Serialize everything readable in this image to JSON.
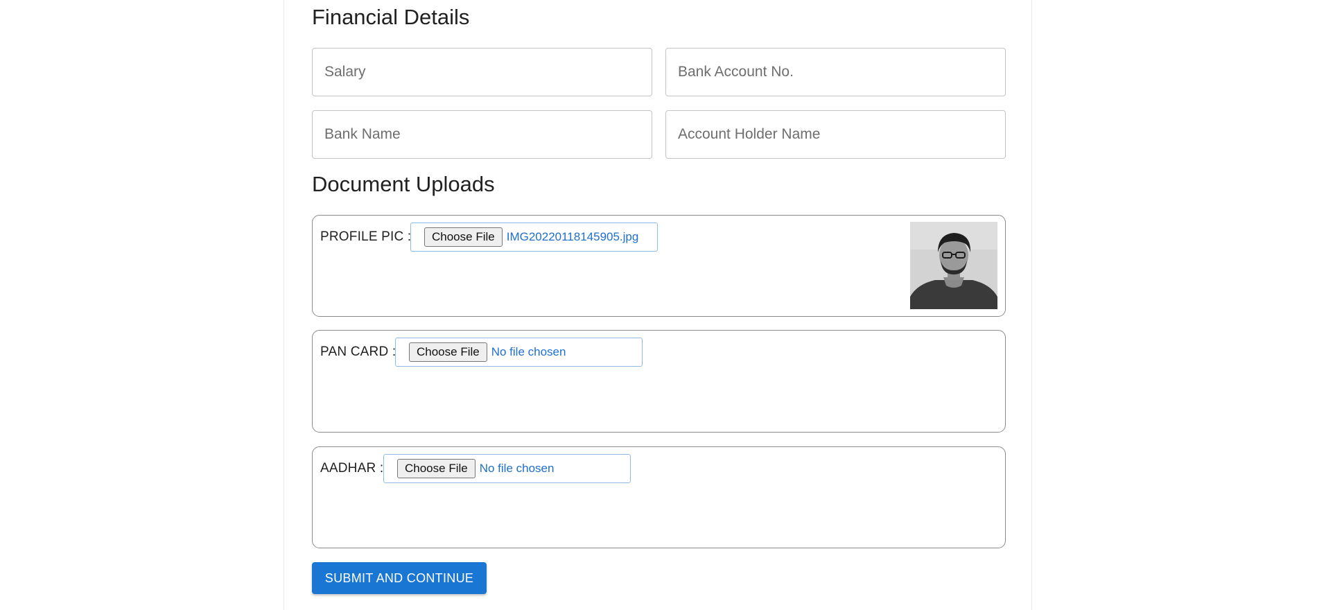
{
  "financial": {
    "title": "Financial Details",
    "salary_placeholder": "Salary",
    "account_no_placeholder": "Bank Account No.",
    "bank_name_placeholder": "Bank Name",
    "holder_placeholder": "Account Holder Name"
  },
  "documents": {
    "title": "Document Uploads",
    "choose_label": "Choose File",
    "profile": {
      "label": "PROFILE PIC :",
      "file": "IMG20220118145905.jpg"
    },
    "pan": {
      "label": "PAN CARD :",
      "file": "No file chosen"
    },
    "aadhar": {
      "label": "AADHAR :",
      "file": "No file chosen"
    }
  },
  "submit_label": "SUBMIT AND CONTINUE",
  "colors": {
    "primary": "#1976d2",
    "file_name_text": "#1e6fcf"
  }
}
